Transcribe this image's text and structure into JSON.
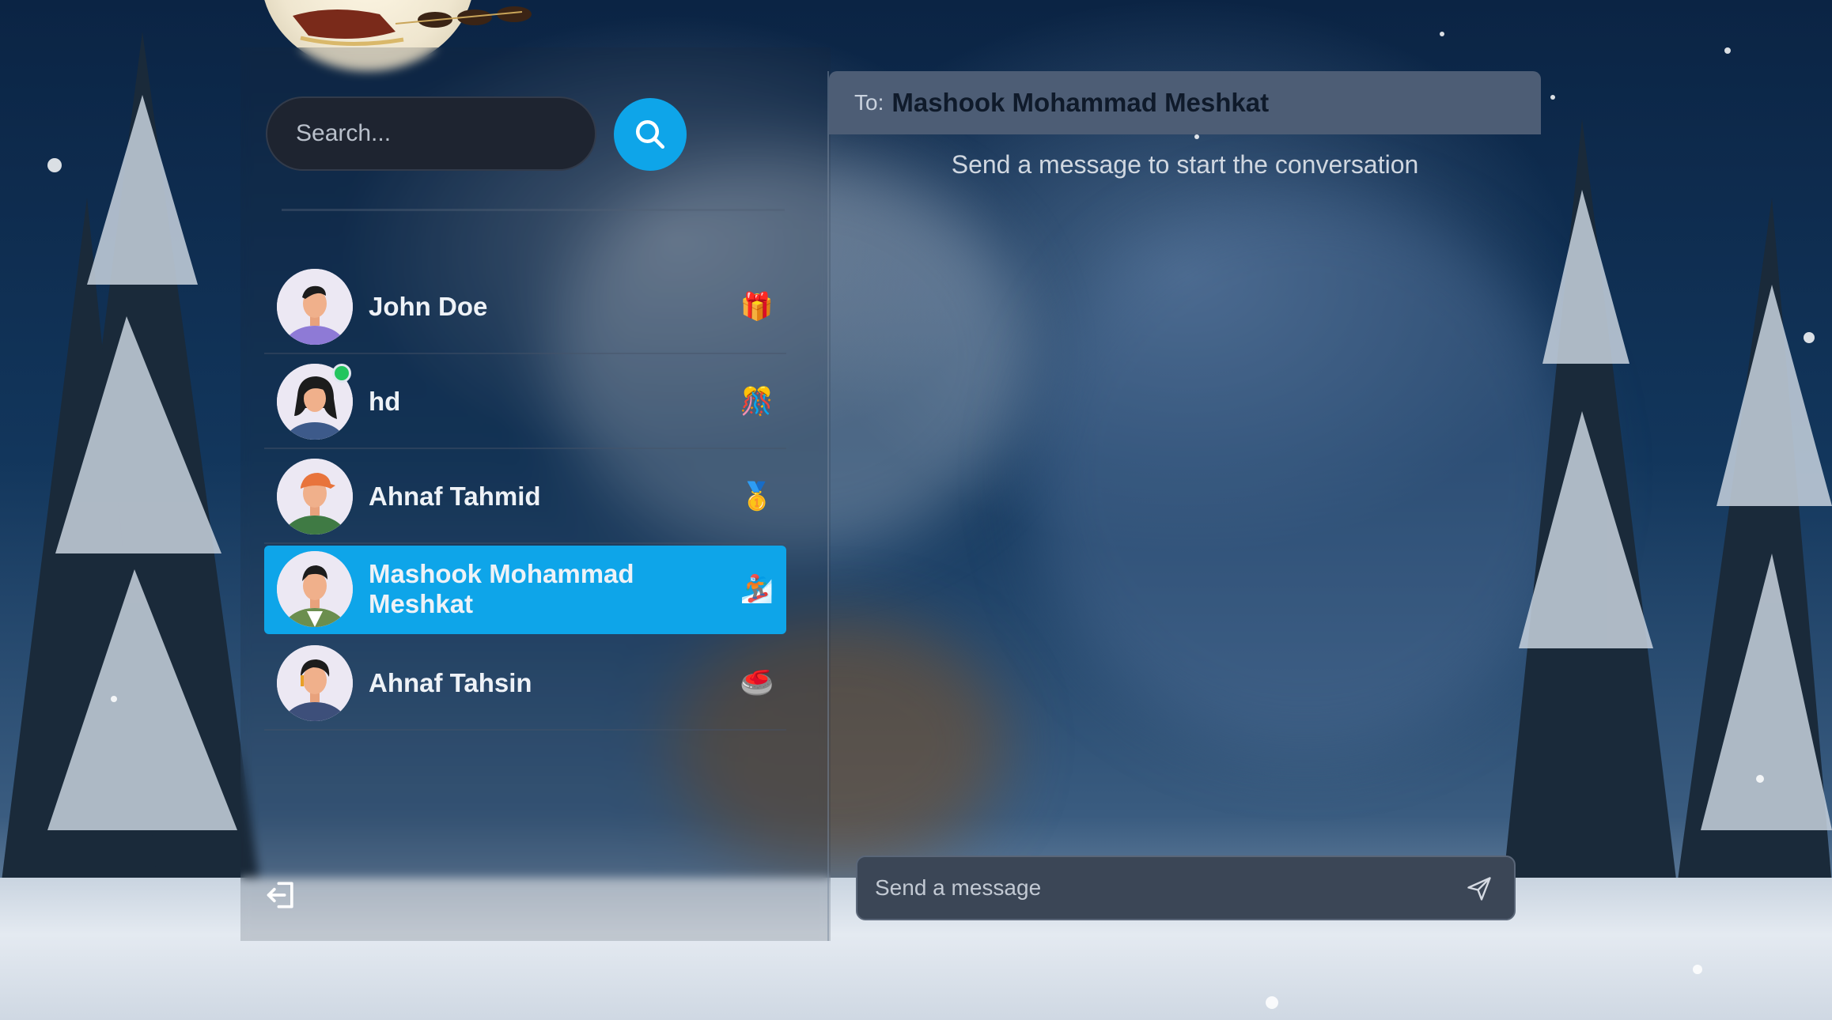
{
  "search": {
    "placeholder": "Search..."
  },
  "contacts": [
    {
      "name": "John Doe",
      "emoji": "🎁",
      "online": false,
      "selected": false
    },
    {
      "name": "hd",
      "emoji": "🎊",
      "online": true,
      "selected": false
    },
    {
      "name": "Ahnaf Tahmid",
      "emoji": "🥇",
      "online": false,
      "selected": false
    },
    {
      "name": "Mashook Mohammad Meshkat",
      "emoji": "🏂",
      "online": false,
      "selected": true
    },
    {
      "name": "Ahnaf Tahsin",
      "emoji": "🥌",
      "online": false,
      "selected": false
    }
  ],
  "chat": {
    "to_label": "To:",
    "recipient": "Mashook Mohammad Meshkat",
    "empty_state": "Send a message to start the conversation",
    "input_placeholder": "Send a message"
  },
  "icons": {
    "search": "search-icon",
    "logout": "logout-icon",
    "send": "send-icon"
  },
  "colors": {
    "accent": "#0ea5e9",
    "online": "#22c55e",
    "header_bg": "#4d5d75"
  }
}
